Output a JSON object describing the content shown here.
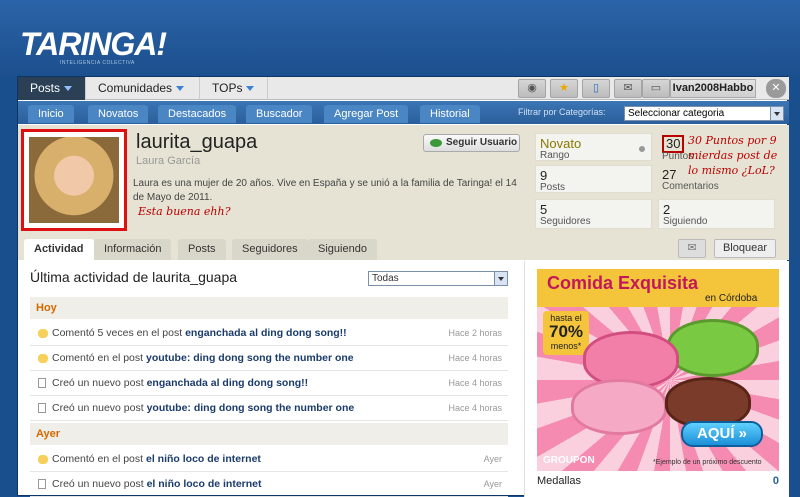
{
  "header": {
    "logo": "TARINGA!",
    "tagline": "INTELIGENCIA COLECTIVA"
  },
  "topnav": {
    "items": [
      {
        "label": "Posts"
      },
      {
        "label": "Comunidades"
      },
      {
        "label": "TOPs"
      }
    ],
    "user": "Ivan2008Habbo",
    "icons": [
      "eye-icon",
      "star-icon",
      "document-icon",
      "mail-icon",
      "monitor-icon",
      "close-icon"
    ]
  },
  "subnav": {
    "items": [
      "Inicio",
      "Novatos",
      "Destacados",
      "Buscador",
      "Agregar Post",
      "Historial"
    ],
    "filter_label": "Filtrar por Categorías:",
    "filter_value": "Seleccionar categoria"
  },
  "profile": {
    "username": "laurita_guapa",
    "realname": "Laura García",
    "bio": "Laura es una mujer de 20 años. Vive en España y se unió a la familia de Taringa! el 14 de Mayo de 2011.",
    "follow_label": "Seguir Usuario",
    "note_avatar": "Esta buena ehh?",
    "note_points": "30 Puntos por 9 mierdas post de lo mismo ¿LoL?",
    "stats": {
      "rango_value": "Novato",
      "rango_label": "Rango",
      "puntos_value": "30",
      "puntos_label": "Puntos",
      "posts_value": "9",
      "posts_label": "Posts",
      "comentarios_value": "27",
      "comentarios_label": "Comentarios",
      "seguidores_value": "5",
      "seguidores_label": "Seguidores",
      "siguiendo_value": "2",
      "siguiendo_label": "Siguiendo"
    }
  },
  "tabs": [
    "Actividad",
    "Información",
    "Posts",
    "Seguidores",
    "Siguiendo"
  ],
  "block_label": "Bloquear",
  "activity": {
    "title": "Última actividad de laurita_guapa",
    "filter": "Todas",
    "hoy": "Hoy",
    "ayer": "Ayer",
    "rows": [
      {
        "prefix": "Comentó 5 veces en el post",
        "link": "enganchada al ding dong song!!",
        "time": "Hace 2 horas",
        "icon": "comment-icon"
      },
      {
        "prefix": "Comentó en el post",
        "link": "youtube: ding dong song the number one",
        "time": "Hace 4 horas",
        "icon": "comment-icon"
      },
      {
        "prefix": "Creó un nuevo post",
        "link": "enganchada al ding dong song!!",
        "time": "Hace 4 horas",
        "icon": "document-icon"
      },
      {
        "prefix": "Creó un nuevo post",
        "link": "youtube: ding dong song the number one",
        "time": "Hace 4 horas",
        "icon": "document-icon"
      },
      {
        "prefix": "Comentó en el post",
        "link": "el niño loco de internet",
        "time": "Ayer",
        "icon": "comment-icon"
      },
      {
        "prefix": "Creó un nuevo post",
        "link": "el niño loco de internet",
        "time": "Ayer",
        "icon": "document-icon"
      }
    ]
  },
  "ad": {
    "title": "Comida Exquisita",
    "subtitle": "en Córdoba",
    "discount_top": "hasta el",
    "discount": "70%",
    "discount_bottom": "menos*",
    "button": "AQUÍ »",
    "brand": "GROUPON",
    "footnote": "*Ejemplo de un próximo descuento"
  },
  "medallas": {
    "label": "Medallas",
    "count": "0"
  }
}
